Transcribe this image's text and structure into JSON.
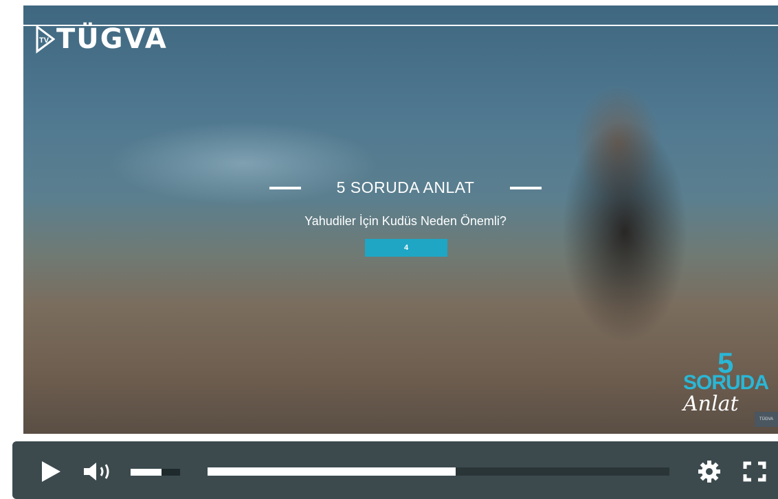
{
  "video": {
    "logo_text": "TÜGVA",
    "logo_badge": "TV",
    "title": "5 SORUDA ANLAT",
    "subtitle": "Yahudiler İçin Kudüs Neden Önemli?",
    "question_number": "4",
    "corner_brand": {
      "number": "5",
      "word1": "SORUDA",
      "word2": "Anlat",
      "tag": "TÜGVA"
    }
  },
  "player": {
    "play_icon": "play-icon",
    "volume_icon": "volume-icon",
    "settings_icon": "gear-icon",
    "fullscreen_icon": "fullscreen-icon",
    "volume_level": 0.62,
    "progress_fraction": 0.537
  },
  "colors": {
    "accent": "#1fa6c4",
    "control_bar": "#3c4a4e"
  }
}
